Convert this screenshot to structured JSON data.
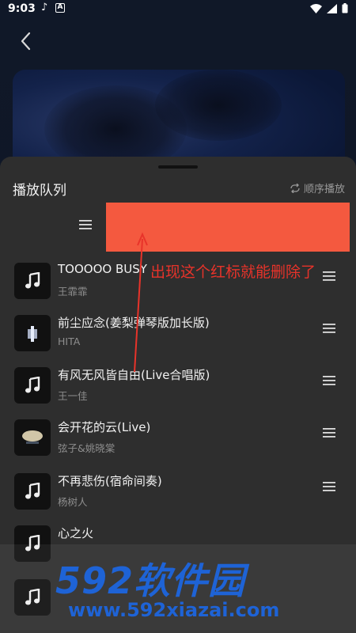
{
  "status_bar": {
    "time": "9:03",
    "app_letter": "A"
  },
  "sheet": {
    "title": "播放队列",
    "order_label": "顺序播放"
  },
  "songs": [
    {
      "title": "TOOOOO BUSY",
      "artist": "王霏霏"
    },
    {
      "title": "前尘应念(姜梨弹琴版加长版)",
      "artist": "HITA"
    },
    {
      "title": "有风无风皆自由(Live合唱版)",
      "artist": "王一佳"
    },
    {
      "title": "会开花的云(Live)",
      "artist": "弦子&姚晓棠"
    },
    {
      "title": "不再悲伤(宿命间奏)",
      "artist": "杨树人"
    },
    {
      "title": "心之火",
      "artist": ""
    }
  ],
  "annotation": {
    "text": "出现这个红标就能删除了"
  },
  "watermark": {
    "logo": "592软件园",
    "url": "www.592xiazai.com"
  },
  "colors": {
    "sheet": "#2e2e2e",
    "delete_mark": "#f4593f",
    "annotation": "#e8332a",
    "watermark": "#1e63d6"
  }
}
